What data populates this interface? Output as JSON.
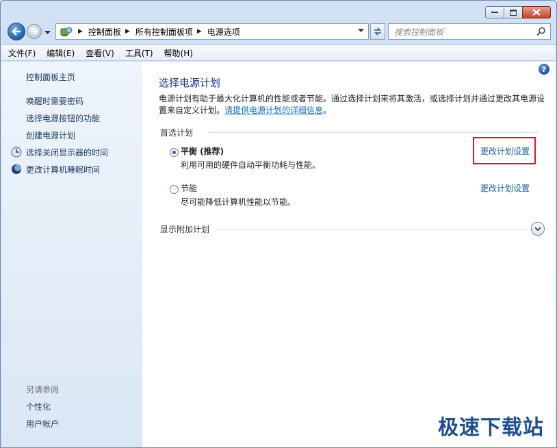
{
  "window": {
    "controls": {
      "minimize": "minimize",
      "maximize": "maximize",
      "close": "close"
    }
  },
  "nav": {
    "breadcrumbs": [
      "控制面板",
      "所有控制面板项",
      "电源选项"
    ],
    "search_placeholder": "搜索控制面板"
  },
  "menu": [
    "文件(F)",
    "编辑(E)",
    "查看(V)",
    "工具(T)",
    "帮助(H)"
  ],
  "sidebar": {
    "home": "控制面板主页",
    "links": [
      "唤醒时需要密码",
      "选择电源按钮的功能",
      "创建电源计划",
      "选择关闭显示器的时间",
      "更改计算机睡眠时间"
    ],
    "see_also_title": "另请参阅",
    "see_also": [
      "个性化",
      "用户帐户"
    ]
  },
  "content": {
    "title": "选择电源计划",
    "description": "电源计划有助于最大化计算机的性能或者节能。通过选择计划来将其激活，或选择计划并通过更改其电源设置来自定义计划。",
    "description_link": "请提供电源计划的详细信息",
    "description_end": "。",
    "preferred_title": "首选计划",
    "plans": [
      {
        "name": "平衡 (推荐)",
        "desc": "利用可用的硬件自动平衡功耗与性能。",
        "link": "更改计划设置",
        "selected": true
      },
      {
        "name": "节能",
        "desc": "尽可能降低计算机性能以节能。",
        "link": "更改计划设置",
        "selected": false
      }
    ],
    "additional_title": "显示附加计划",
    "help": "?"
  },
  "watermark": "极速下载站",
  "colors": {
    "highlight": "#d11f1f",
    "link": "#1a5fa3",
    "title": "#1e3287"
  }
}
